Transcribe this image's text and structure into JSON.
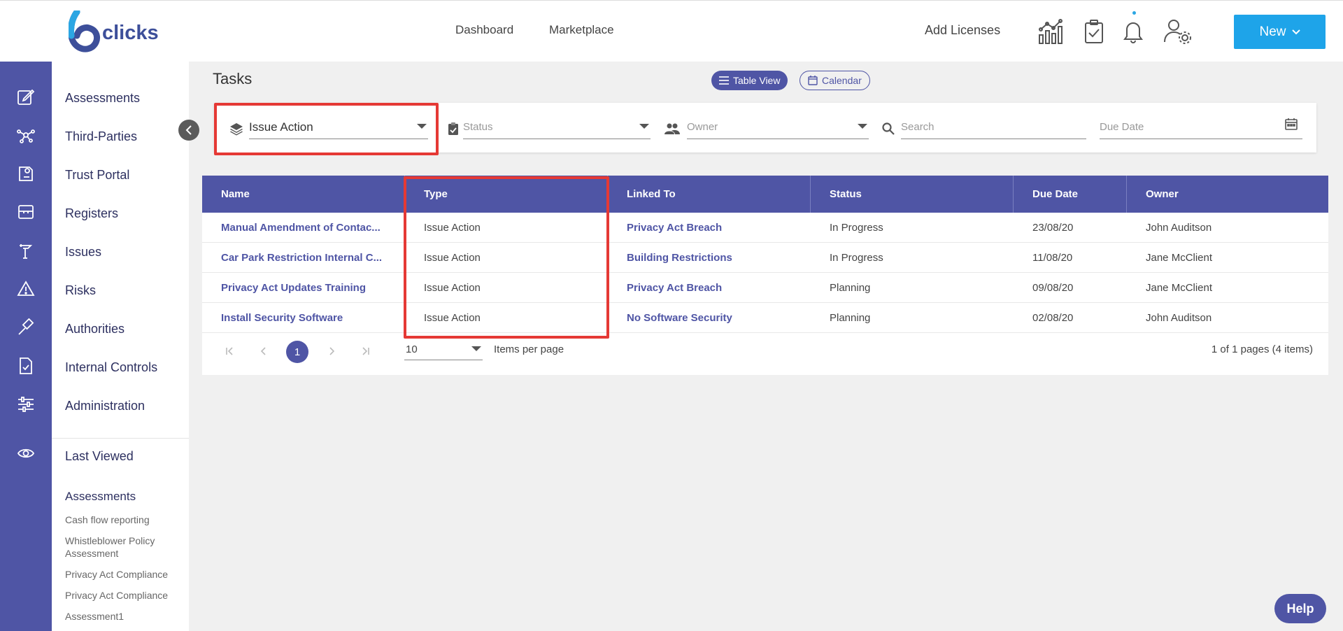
{
  "brand": {
    "logo_text": "clicks"
  },
  "topnav": {
    "dashboard": "Dashboard",
    "marketplace": "Marketplace",
    "add_licenses": "Add Licenses",
    "new_button": "New"
  },
  "sidebar": {
    "items": [
      {
        "label": "Assessments"
      },
      {
        "label": "Third-Parties"
      },
      {
        "label": "Trust Portal"
      },
      {
        "label": "Registers"
      },
      {
        "label": "Issues"
      },
      {
        "label": "Risks"
      },
      {
        "label": "Authorities"
      },
      {
        "label": "Internal Controls"
      },
      {
        "label": "Administration"
      }
    ],
    "last_viewed": {
      "title": "Last Viewed",
      "section": "Assessments",
      "items": [
        "Cash flow reporting",
        "Whistleblower Policy Assessment",
        "Privacy Act Compliance",
        "Privacy Act Compliance",
        "Assessment1"
      ]
    }
  },
  "page": {
    "title": "Tasks",
    "view_table": "Table View",
    "view_calendar": "Calendar"
  },
  "filters": {
    "type_value": "Issue Action",
    "status_placeholder": "Status",
    "owner_placeholder": "Owner",
    "search_placeholder": "Search",
    "due_date_placeholder": "Due Date"
  },
  "table": {
    "headers": [
      "Name",
      "Type",
      "Linked To",
      "Status",
      "Due Date",
      "Owner"
    ],
    "rows": [
      {
        "name": "Manual Amendment of Contac...",
        "type": "Issue Action",
        "linked_to": "Privacy Act Breach",
        "status": "In Progress",
        "due_date": "23/08/20",
        "owner": "John Auditson"
      },
      {
        "name": "Car Park Restriction Internal C...",
        "type": "Issue Action",
        "linked_to": "Building Restrictions",
        "status": "In Progress",
        "due_date": "11/08/20",
        "owner": "Jane McClient"
      },
      {
        "name": "Privacy Act Updates Training",
        "type": "Issue Action",
        "linked_to": "Privacy Act Breach",
        "status": "Planning",
        "due_date": "09/08/20",
        "owner": "Jane McClient"
      },
      {
        "name": "Install Security Software",
        "type": "Issue Action",
        "linked_to": "No Software Security",
        "status": "Planning",
        "due_date": "02/08/20",
        "owner": "John Auditson"
      }
    ]
  },
  "pager": {
    "current_page": "1",
    "page_size": "10",
    "items_per_page_label": "Items per page",
    "info": "1 of 1 pages (4 items)"
  },
  "help": {
    "label": "Help"
  },
  "colors": {
    "primary": "#4f55a5",
    "accent": "#1ea4e9",
    "highlight": "#e53935"
  }
}
